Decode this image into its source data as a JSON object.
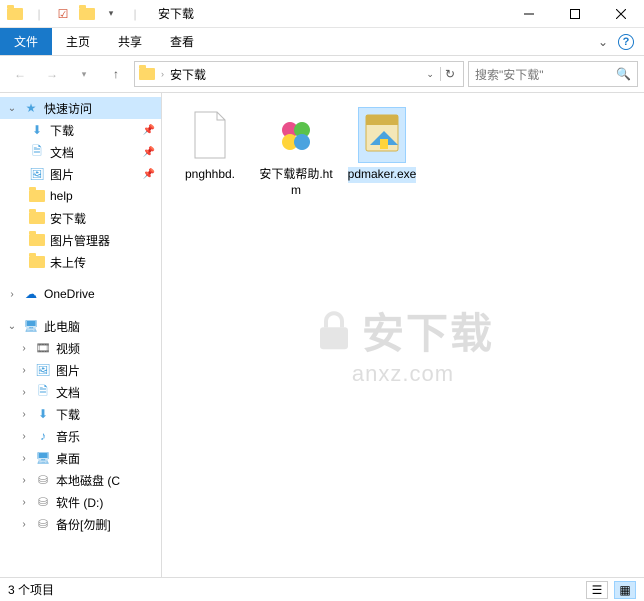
{
  "window": {
    "title": "安下载",
    "minimize": "–",
    "maximize": "☐",
    "close": "✕"
  },
  "ribbon": {
    "tabs": [
      "文件",
      "主页",
      "共享",
      "查看"
    ]
  },
  "address": {
    "path": "安下载",
    "search_placeholder": "搜索\"安下载\""
  },
  "sidebar": {
    "quick_access": "快速访问",
    "items1": [
      {
        "label": "下载",
        "pinned": true,
        "icon": "download"
      },
      {
        "label": "文档",
        "pinned": true,
        "icon": "doc"
      },
      {
        "label": "图片",
        "pinned": true,
        "icon": "pic"
      },
      {
        "label": "help",
        "pinned": false,
        "icon": "folder"
      },
      {
        "label": "安下载",
        "pinned": false,
        "icon": "folder"
      },
      {
        "label": "图片管理器",
        "pinned": false,
        "icon": "folder"
      },
      {
        "label": "未上传",
        "pinned": false,
        "icon": "folder"
      }
    ],
    "onedrive": "OneDrive",
    "thispc": "此电脑",
    "items2": [
      {
        "label": "视频",
        "icon": "video"
      },
      {
        "label": "图片",
        "icon": "pic"
      },
      {
        "label": "文档",
        "icon": "doc"
      },
      {
        "label": "下载",
        "icon": "download"
      },
      {
        "label": "音乐",
        "icon": "music"
      },
      {
        "label": "桌面",
        "icon": "desktop"
      },
      {
        "label": "本地磁盘 (C",
        "icon": "disk"
      },
      {
        "label": "软件 (D:)",
        "icon": "disk"
      },
      {
        "label": "备份[勿删]",
        "icon": "disk"
      }
    ]
  },
  "files": [
    {
      "name": "pnghhbd.",
      "type": "blank"
    },
    {
      "name": "安下载帮助.htm",
      "type": "htm"
    },
    {
      "name": "pdmaker.exe",
      "type": "exe",
      "selected": true
    }
  ],
  "status": {
    "count": "3 个项目"
  },
  "watermark": {
    "line1": "安下载",
    "line2": "anxz.com"
  }
}
